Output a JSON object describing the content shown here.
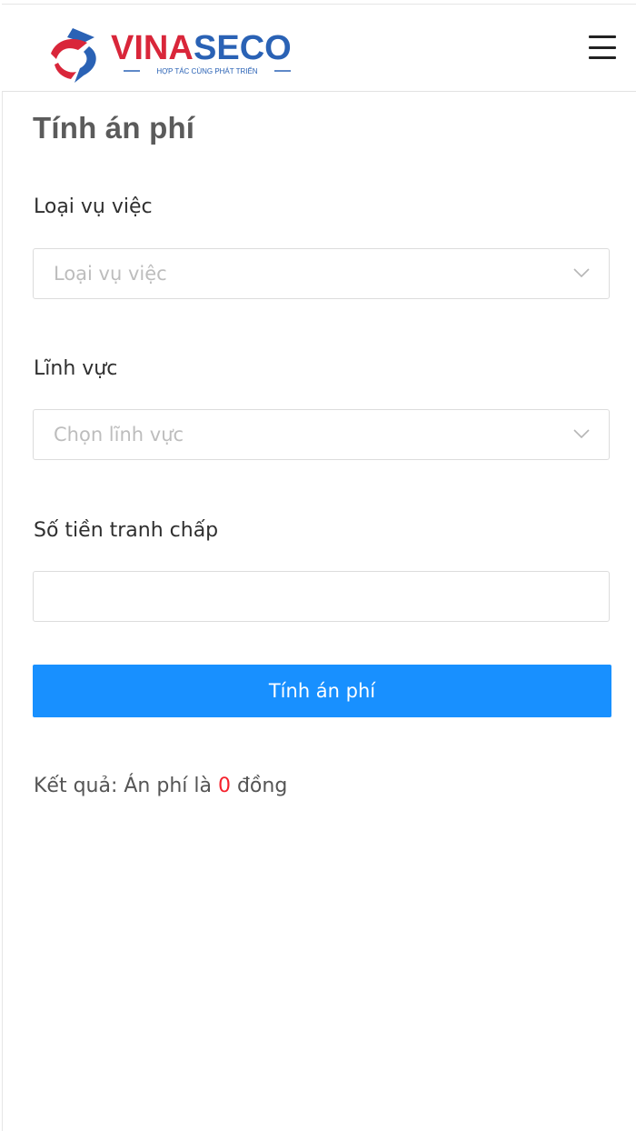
{
  "header": {
    "logo_text": "VINASECO",
    "logo_tagline": "HỢP TÁC CÙNG PHÁT TRIỂN",
    "menu_icon": "hamburger-icon",
    "brand_colors": {
      "red": "#d9263a",
      "blue": "#2a62b5"
    }
  },
  "page": {
    "title": "Tính án phí"
  },
  "form": {
    "case_type": {
      "label": "Loại vụ việc",
      "placeholder": "Loại vụ việc"
    },
    "field": {
      "label": "Lĩnh vực",
      "placeholder": "Chọn lĩnh vực"
    },
    "amount": {
      "label": "Số tiền tranh chấp",
      "value": ""
    },
    "submit_label": "Tính án phí",
    "accent_color": "#1890ff"
  },
  "result": {
    "prefix": "Kết quả: Án phí là ",
    "value": "0",
    "suffix": " đồng",
    "value_color": "#f5222d"
  }
}
